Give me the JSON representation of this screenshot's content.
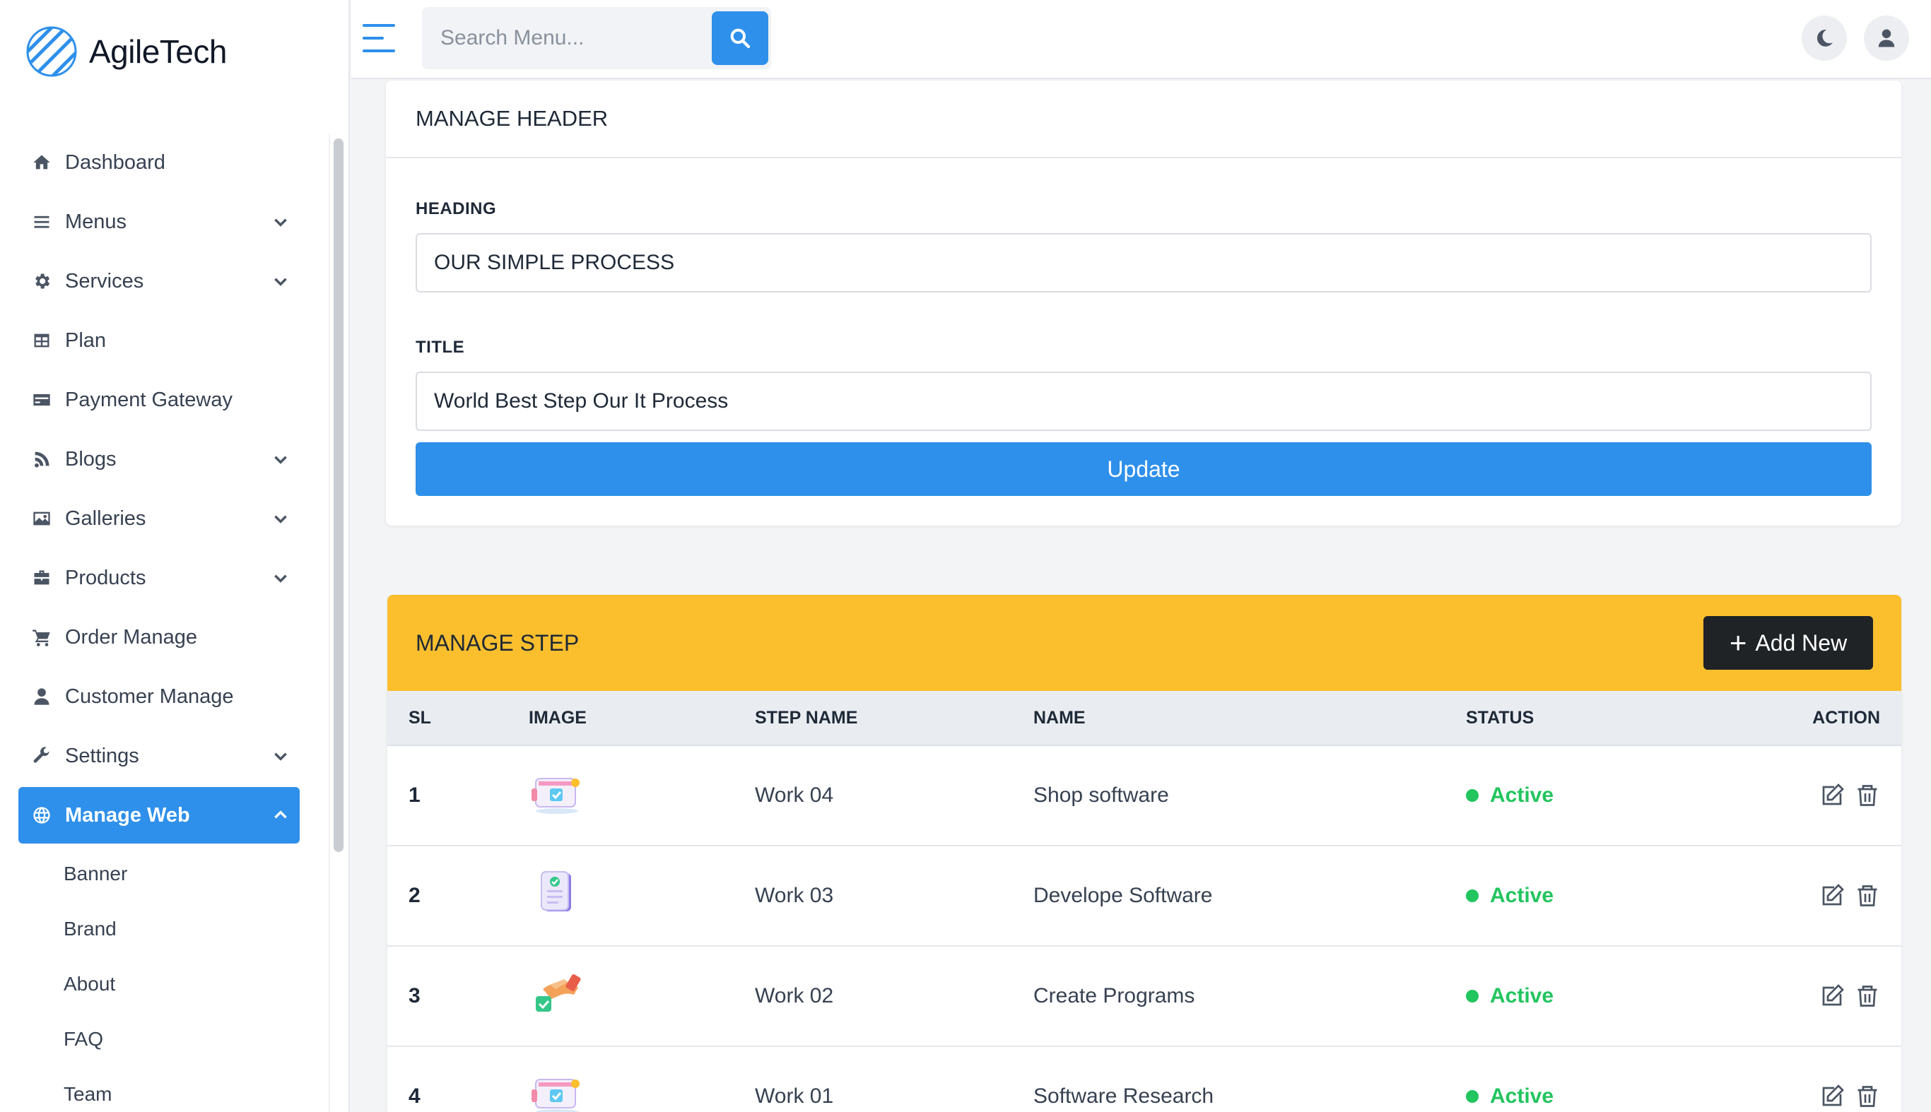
{
  "app": {
    "name": "AgileTech"
  },
  "search": {
    "placeholder": "Search Menu..."
  },
  "sidebar": {
    "items": [
      {
        "label": "Dashboard",
        "icon": "home-icon",
        "chevron": false
      },
      {
        "label": "Menus",
        "icon": "list-icon",
        "chevron": true
      },
      {
        "label": "Services",
        "icon": "gear-icon",
        "chevron": true
      },
      {
        "label": "Plan",
        "icon": "table-icon",
        "chevron": false
      },
      {
        "label": "Payment Gateway",
        "icon": "credit-card-icon",
        "chevron": false
      },
      {
        "label": "Blogs",
        "icon": "blog-icon",
        "chevron": true
      },
      {
        "label": "Galleries",
        "icon": "image-icon",
        "chevron": true
      },
      {
        "label": "Products",
        "icon": "briefcase-icon",
        "chevron": true
      },
      {
        "label": "Order Manage",
        "icon": "cart-icon",
        "chevron": false
      },
      {
        "label": "Customer Manage",
        "icon": "user-icon",
        "chevron": false
      },
      {
        "label": "Settings",
        "icon": "wrench-icon",
        "chevron": true
      },
      {
        "label": "Manage Web",
        "icon": "globe-icon",
        "chevron": true,
        "active": true
      }
    ],
    "subitems": [
      "Banner",
      "Brand",
      "About",
      "FAQ",
      "Team"
    ]
  },
  "header_card": {
    "title": "MANAGE HEADER",
    "heading_label": "HEADING",
    "heading_value": "OUR SIMPLE PROCESS",
    "title_label": "TITLE",
    "title_value": "World Best Step Our It Process",
    "update_label": "Update"
  },
  "step_card": {
    "title": "MANAGE STEP",
    "add_label": "Add New",
    "columns": [
      "SL",
      "IMAGE",
      "STEP NAME",
      "NAME",
      "STATUS",
      "ACTION"
    ],
    "rows": [
      {
        "sl": "1",
        "step": "Work 04",
        "name": "Shop software",
        "status": "Active",
        "image": "monitor-check-icon"
      },
      {
        "sl": "2",
        "step": "Work 03",
        "name": "Develope Software",
        "status": "Active",
        "image": "clipboard-check-icon"
      },
      {
        "sl": "3",
        "step": "Work 02",
        "name": "Create Programs",
        "status": "Active",
        "image": "hand-check-icon"
      },
      {
        "sl": "4",
        "step": "Work 01",
        "name": "Software Research",
        "status": "Active",
        "image": "monitor-check-icon"
      }
    ]
  },
  "colors": {
    "accent": "#2e90ea",
    "warning": "#fbbf2d",
    "success": "#22c55e",
    "dark": "#1f2326"
  }
}
